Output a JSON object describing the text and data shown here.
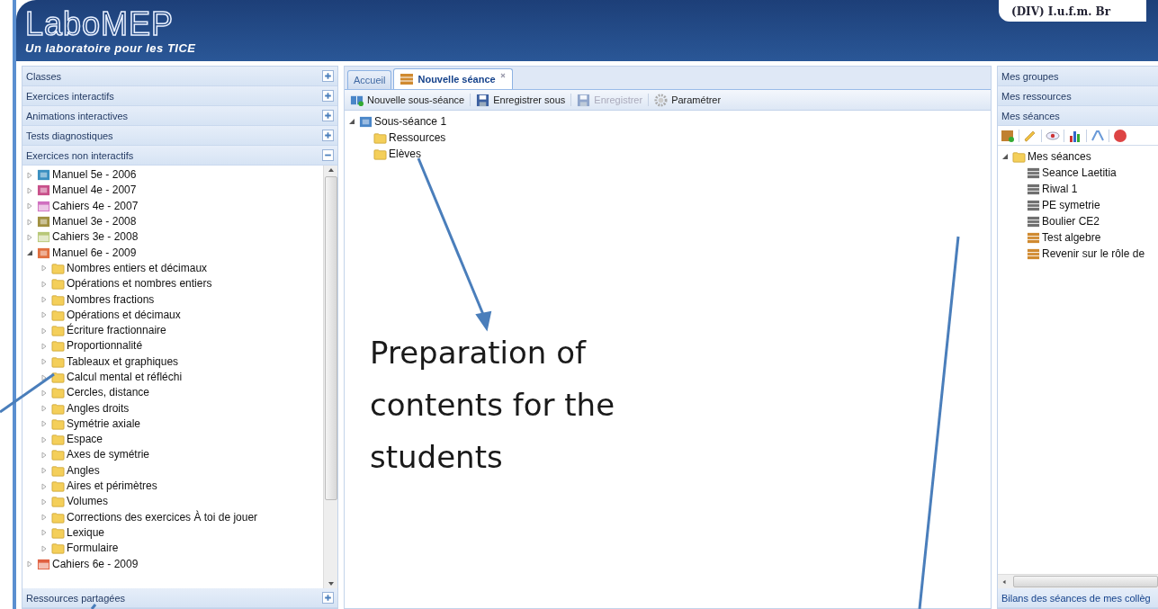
{
  "header": {
    "logo": "LaboMEP",
    "tagline": "Un laboratoire pour les TICE",
    "user": "(DIV) I.u.f.m. Br"
  },
  "left_panel": {
    "sections_top": [
      {
        "title": "Classes",
        "expanded": false
      },
      {
        "title": "Exercices interactifs",
        "expanded": false
      },
      {
        "title": "Animations interactives",
        "expanded": false
      },
      {
        "title": "Tests diagnostiques",
        "expanded": false
      },
      {
        "title": "Exercices non interactifs",
        "expanded": true
      }
    ],
    "tree": [
      {
        "label": "Manuel 5e - 2006",
        "kind": "book",
        "color": "#3a8fc0",
        "expanded": false
      },
      {
        "label": "Manuel 4e - 2007",
        "kind": "book",
        "color": "#c8508a",
        "expanded": false
      },
      {
        "label": "Cahiers 4e - 2007",
        "kind": "workbook",
        "color": "#d070c0",
        "expanded": false
      },
      {
        "label": "Manuel 3e - 2008",
        "kind": "book",
        "color": "#a09040",
        "expanded": false
      },
      {
        "label": "Cahiers 3e - 2008",
        "kind": "workbook",
        "color": "#b8c878",
        "expanded": false
      },
      {
        "label": "Manuel 6e - 2009",
        "kind": "book",
        "color": "#e07040",
        "expanded": true,
        "children": [
          {
            "label": "Nombres entiers et décimaux",
            "kind": "folder",
            "expanded": false
          },
          {
            "label": "Opérations et nombres entiers",
            "kind": "folder",
            "expanded": false
          },
          {
            "label": "Nombres fractions",
            "kind": "folder",
            "expanded": false
          },
          {
            "label": "Opérations et décimaux",
            "kind": "folder",
            "expanded": false
          },
          {
            "label": "Écriture fractionnaire",
            "kind": "folder",
            "expanded": false
          },
          {
            "label": "Proportionnalité",
            "kind": "folder",
            "expanded": false
          },
          {
            "label": "Tableaux et graphiques",
            "kind": "folder",
            "expanded": false
          },
          {
            "label": "Calcul mental et réfléchi",
            "kind": "folder",
            "expanded": false
          },
          {
            "label": "Cercles, distance",
            "kind": "folder",
            "expanded": false
          },
          {
            "label": "Angles droits",
            "kind": "folder",
            "expanded": false
          },
          {
            "label": "Symétrie axiale",
            "kind": "folder",
            "expanded": false
          },
          {
            "label": "Espace",
            "kind": "folder",
            "expanded": false
          },
          {
            "label": "Axes de symétrie",
            "kind": "folder",
            "expanded": false
          },
          {
            "label": "Angles",
            "kind": "folder",
            "expanded": false
          },
          {
            "label": "Aires et périmètres",
            "kind": "folder",
            "expanded": false
          },
          {
            "label": "Volumes",
            "kind": "folder",
            "expanded": false
          },
          {
            "label": "Corrections des exercices À toi de jouer",
            "kind": "folder",
            "expanded": false
          },
          {
            "label": "Lexique",
            "kind": "folder",
            "expanded": false
          },
          {
            "label": "Formulaire",
            "kind": "folder",
            "expanded": false
          }
        ]
      },
      {
        "label": "Cahiers 6e - 2009",
        "kind": "workbook",
        "color": "#e06040",
        "expanded": false
      }
    ],
    "sections_bottom": [
      {
        "title": "Ressources partagées",
        "expanded": false
      }
    ]
  },
  "center_panel": {
    "tabs": [
      {
        "label": "Accueil",
        "selected": false,
        "closable": false
      },
      {
        "label": "Nouvelle séance",
        "selected": true,
        "closable": true
      }
    ],
    "toolbar": [
      {
        "label": "Nouvelle sous-séance",
        "disabled": false
      },
      {
        "label": "Enregistrer sous",
        "disabled": false
      },
      {
        "label": "Enregistrer",
        "disabled": true
      },
      {
        "label": "Paramétrer",
        "disabled": false
      }
    ],
    "tree": [
      {
        "label": "Sous-séance 1",
        "kind": "book",
        "color": "#4a86c8",
        "expanded": true,
        "children": [
          {
            "label": "Ressources",
            "kind": "folder"
          },
          {
            "label": "Elèves",
            "kind": "folder"
          }
        ]
      }
    ],
    "annotation": "Preparation of contents for the students"
  },
  "right_panel": {
    "sections": [
      {
        "title": "Mes groupes"
      },
      {
        "title": "Mes ressources"
      },
      {
        "title": "Mes séances"
      }
    ],
    "tree": [
      {
        "label": "Mes séances",
        "kind": "folder",
        "expanded": true,
        "children": [
          {
            "label": "Seance Laetitia",
            "kind": "seance",
            "color": "#707070"
          },
          {
            "label": "Riwal 1",
            "kind": "seance",
            "color": "#707070"
          },
          {
            "label": "PE symetrie",
            "kind": "seance",
            "color": "#707070"
          },
          {
            "label": "Boulier CE2",
            "kind": "seance",
            "color": "#707070"
          },
          {
            "label": "Test algebre",
            "kind": "seance",
            "color": "#d08a30"
          },
          {
            "label": "Revenir sur le rôle de",
            "kind": "seance",
            "color": "#d08a30"
          }
        ]
      }
    ],
    "footer": "Bilans des séances de mes collèg"
  }
}
